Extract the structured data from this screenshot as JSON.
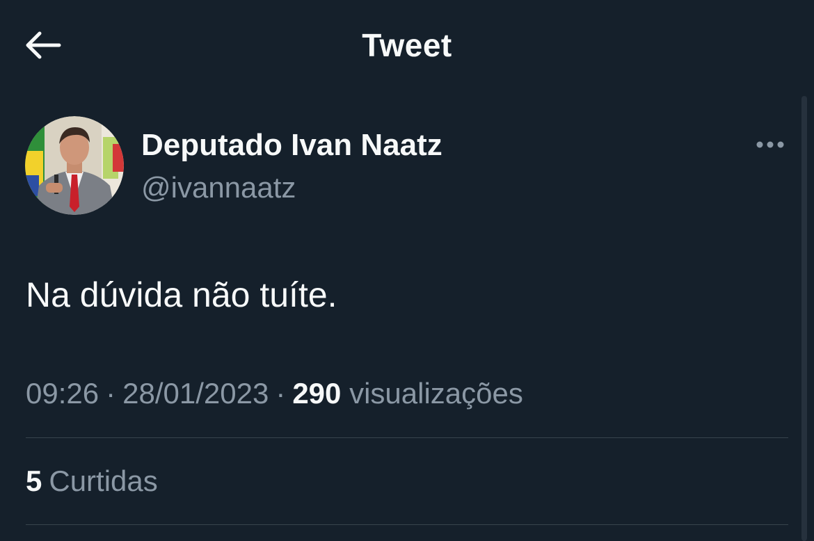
{
  "header": {
    "back_icon": "arrow-left-icon",
    "title": "Tweet"
  },
  "author": {
    "display_name": "Deputado Ivan Naatz",
    "handle": "@ivannaatz",
    "avatar": "profile-photo"
  },
  "more_icon": "ellipsis-horizontal-icon",
  "tweet": {
    "text": "Na dúvida não tuíte.",
    "time": "09:26",
    "date": "28/01/2023",
    "separator": "·",
    "views_count": "290",
    "views_label": "visualizações"
  },
  "stats": {
    "likes_count": "5",
    "likes_label": "Curtidas"
  },
  "colors": {
    "background": "#15202b",
    "text_primary": "#f7f9f9",
    "text_secondary": "#8b98a5",
    "divider": "#38444d"
  }
}
